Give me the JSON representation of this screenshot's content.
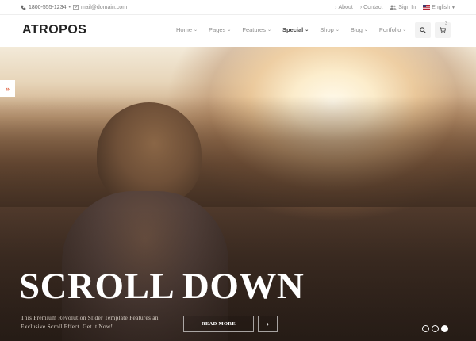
{
  "topbar": {
    "phone": "1800-555-1234",
    "separator": "•",
    "email": "mail@domain.com",
    "links": [
      {
        "label": "About",
        "icon": "chevron-right-icon"
      },
      {
        "label": "Contact",
        "icon": "chevron-right-icon"
      },
      {
        "label": "Sign In",
        "icon": "users-icon"
      }
    ],
    "language": "English",
    "language_flag": "us-flag-icon"
  },
  "header": {
    "logo": "ATROPOS",
    "nav": [
      {
        "label": "Home"
      },
      {
        "label": "Pages"
      },
      {
        "label": "Features"
      },
      {
        "label": "Special"
      },
      {
        "label": "Shop"
      },
      {
        "label": "Blog"
      },
      {
        "label": "Portfolio"
      }
    ],
    "active_nav": "Special",
    "cart_count": "3"
  },
  "hero": {
    "title": "SCROLL DOWN",
    "subtitle": "This Premium Revolution Slider Template Features an Exclusive Scroll Effect. Get it Now!",
    "cta_label": "READ MORE",
    "side_arrow": "»",
    "next_arrow": "›",
    "slides_total": 3,
    "slide_active": 3
  },
  "colors": {
    "accent": "#e0684a",
    "text_muted": "#8e8e8e",
    "hero_text": "#ffffff"
  }
}
